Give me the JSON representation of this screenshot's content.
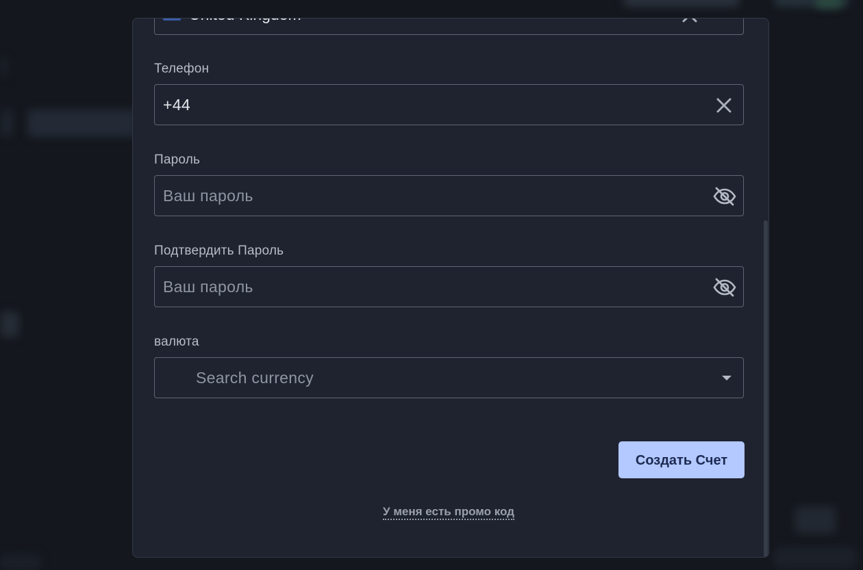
{
  "country": {
    "value": "United Kingdom"
  },
  "phone": {
    "label": "Телефон",
    "value": "+44"
  },
  "password": {
    "label": "Пароль",
    "placeholder": "Ваш пароль"
  },
  "confirm_password": {
    "label": "Подтвердить Пароль",
    "placeholder": "Ваш пароль"
  },
  "currency": {
    "label": "валюта",
    "placeholder": "Search currency"
  },
  "submit": {
    "label": "Создать Счет"
  },
  "promo": {
    "label": "У меня есть промо код"
  },
  "colors": {
    "accent": "#b3c9ff",
    "modal_bg": "#1f2330",
    "page_bg": "#14171d",
    "field_border": "#5f6672"
  },
  "icons": {
    "clear": "close-icon",
    "visibility": "eye-off-icon",
    "dropdown": "caret-down-icon"
  }
}
